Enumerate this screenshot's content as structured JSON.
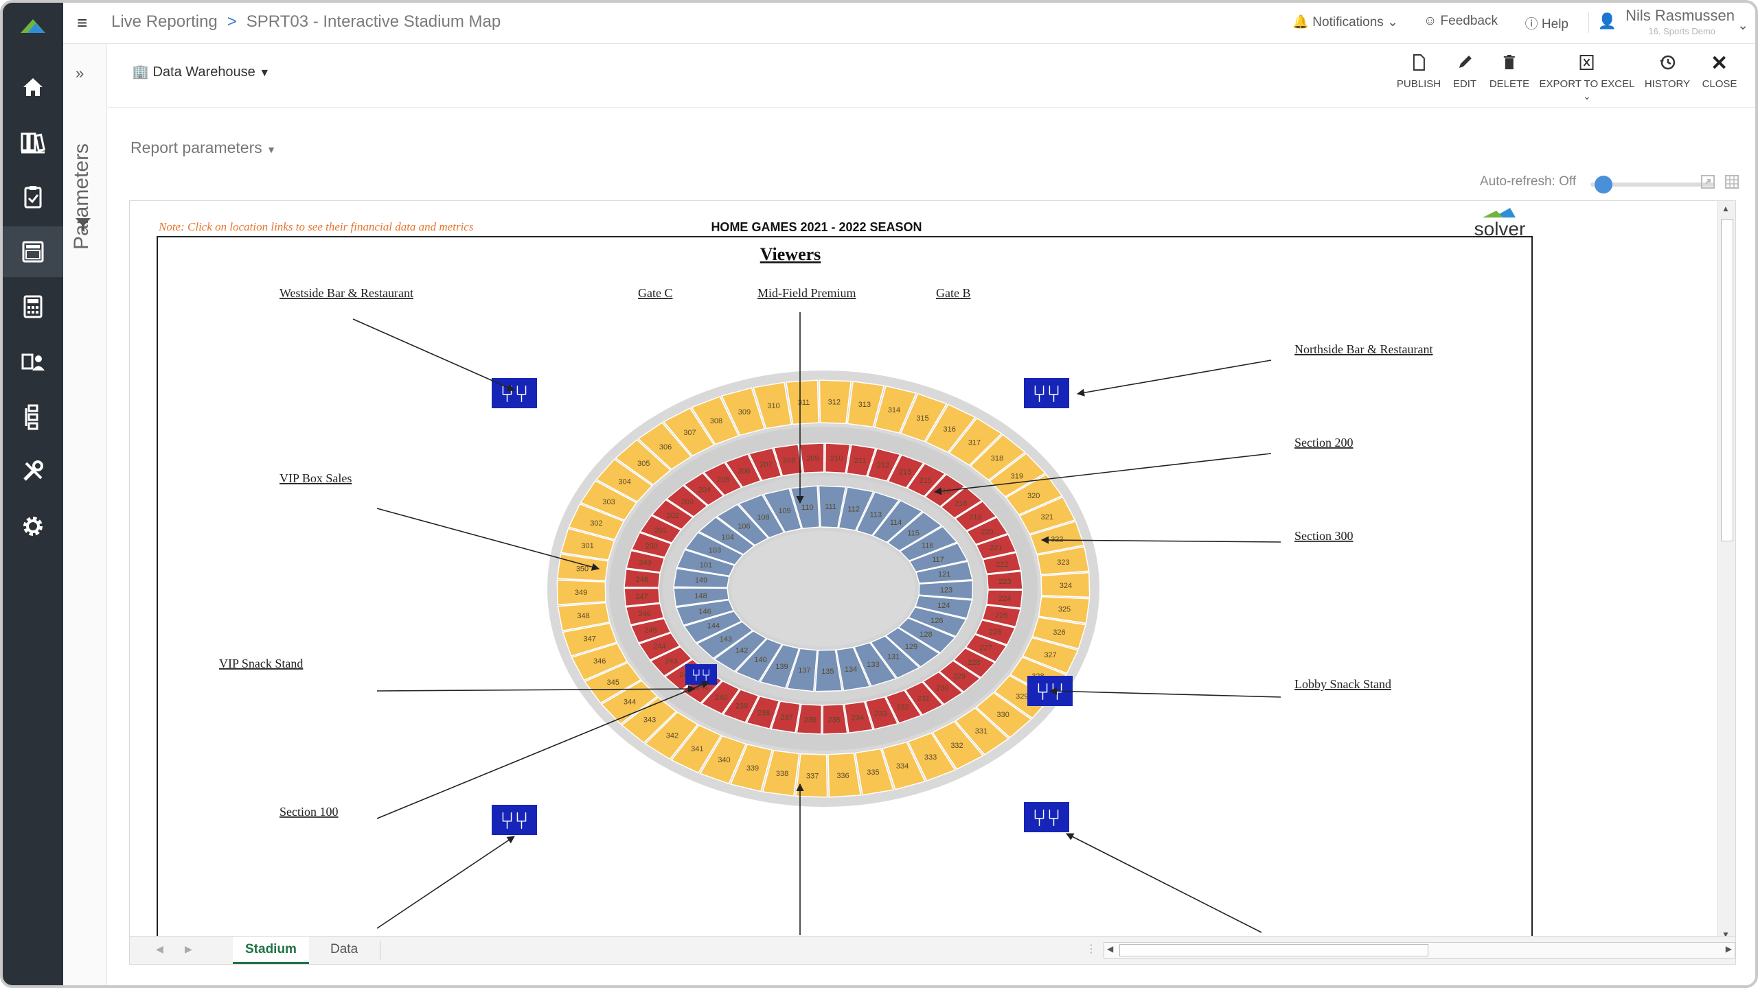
{
  "app": {
    "breadcrumb_root": "Live Reporting",
    "breadcrumb_sep": ">",
    "breadcrumb_page": "SPRT03 - Interactive Stadium Map"
  },
  "topbar": {
    "notifications": "Notifications",
    "feedback": "Feedback",
    "help": "Help",
    "user_name": "Nils Rasmussen",
    "user_org": "16. Sports Demo"
  },
  "sidebar": {
    "items": [
      "home-icon",
      "library-icon",
      "clipboard-icon",
      "report-icon",
      "calculator-icon",
      "users-icon",
      "hierarchy-icon",
      "tools-icon",
      "gear-icon"
    ],
    "parameters_label": "Parameters"
  },
  "main": {
    "data_source": "Data Warehouse",
    "report_parameters": "Report parameters",
    "auto_refresh": "Auto-refresh: Off"
  },
  "toolbar": {
    "publish": "PUBLISH",
    "edit": "EDIT",
    "delete": "DELETE",
    "export": "EXPORT TO EXCEL",
    "history": "HISTORY",
    "close": "CLOSE"
  },
  "report": {
    "note": "Note: Click on location links to see their financial data and metrics",
    "title": "HOME GAMES 2021 - 2022 SEASON",
    "brand": "solver",
    "heading": "Viewers",
    "links": {
      "westside_bar": "Westside Bar & Restaurant",
      "gate_c": "Gate C",
      "mid_field": "Mid-Field Premium",
      "gate_b": "Gate B",
      "northside_bar": "Northside Bar & Restaurant",
      "section_200": "Section 200",
      "vip_box": "VIP Box Sales",
      "section_300": "Section 300",
      "vip_snack": "VIP Snack Stand",
      "lobby_snack": "Lobby Snack Stand",
      "section_100": "Section 100"
    },
    "sections": {
      "s300": [
        "311",
        "312",
        "313",
        "314",
        "315",
        "316",
        "317",
        "318",
        "319",
        "320",
        "321",
        "322",
        "323",
        "324",
        "325",
        "326",
        "327",
        "328",
        "329",
        "330",
        "331",
        "332",
        "333",
        "334",
        "335",
        "336",
        "337",
        "338",
        "339",
        "340",
        "341",
        "342",
        "343",
        "344",
        "345",
        "346",
        "347",
        "348",
        "349",
        "350",
        "301",
        "302",
        "303",
        "304",
        "305",
        "306",
        "307",
        "308",
        "309",
        "310"
      ],
      "s100": [
        "110",
        "111",
        "112",
        "113",
        "114",
        "115",
        "116",
        "117",
        "121",
        "123",
        "124",
        "126",
        "128",
        "129",
        "131",
        "133",
        "134",
        "135",
        "137",
        "139",
        "140",
        "142",
        "143",
        "144",
        "146",
        "148",
        "149",
        "101",
        "103",
        "104",
        "106",
        "108",
        "109"
      ],
      "s200": [
        "209",
        "210",
        "211",
        "212",
        "213",
        "215",
        "216",
        "218",
        "219",
        "220",
        "221",
        "222",
        "223",
        "224",
        "225",
        "226",
        "227",
        "228",
        "229",
        "230",
        "231",
        "232",
        "233",
        "234",
        "235",
        "236",
        "237",
        "238",
        "239",
        "240",
        "241",
        "242",
        "243",
        "244",
        "245",
        "246",
        "247",
        "248",
        "249",
        "250",
        "201",
        "202",
        "203",
        "204",
        "205",
        "206",
        "207",
        "208"
      ]
    }
  },
  "sheets": {
    "stadium": "Stadium",
    "data": "Data"
  }
}
